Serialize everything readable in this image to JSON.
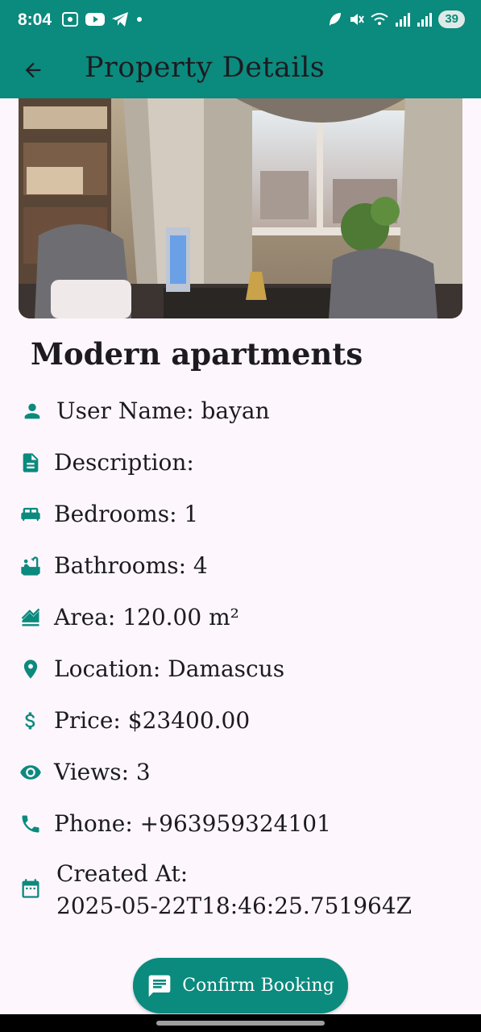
{
  "status_bar": {
    "time": "8:04",
    "battery": "39"
  },
  "app_bar": {
    "title": "Property Details",
    "back_icon": "arrow-back-icon"
  },
  "property": {
    "title": "Modern apartments",
    "details": [
      {
        "icon": "person-icon",
        "text": "User Name: bayan"
      },
      {
        "icon": "description-icon",
        "text": "Description:"
      },
      {
        "icon": "bed-icon",
        "text": "Bedrooms: 1"
      },
      {
        "icon": "bathtub-icon",
        "text": "Bathrooms: 4"
      },
      {
        "icon": "area-icon",
        "text": "Area: 120.00 m²"
      },
      {
        "icon": "location-pin-icon",
        "text": "Location: Damascus"
      },
      {
        "icon": "dollar-icon",
        "text": "Price: $23400.00"
      },
      {
        "icon": "eye-icon",
        "text": "Views: 3"
      },
      {
        "icon": "phone-icon",
        "text": "Phone: +963959324101"
      }
    ],
    "created_label": "Created At:",
    "created_value": "2025-05-22T18:46:25.751964Z"
  },
  "actions": {
    "confirm_label": "Confirm Booking",
    "confirm_icon": "message-icon"
  },
  "colors": {
    "primary": "#0b8a7e",
    "background": "#fdf7fd",
    "text": "#1d1b20"
  }
}
